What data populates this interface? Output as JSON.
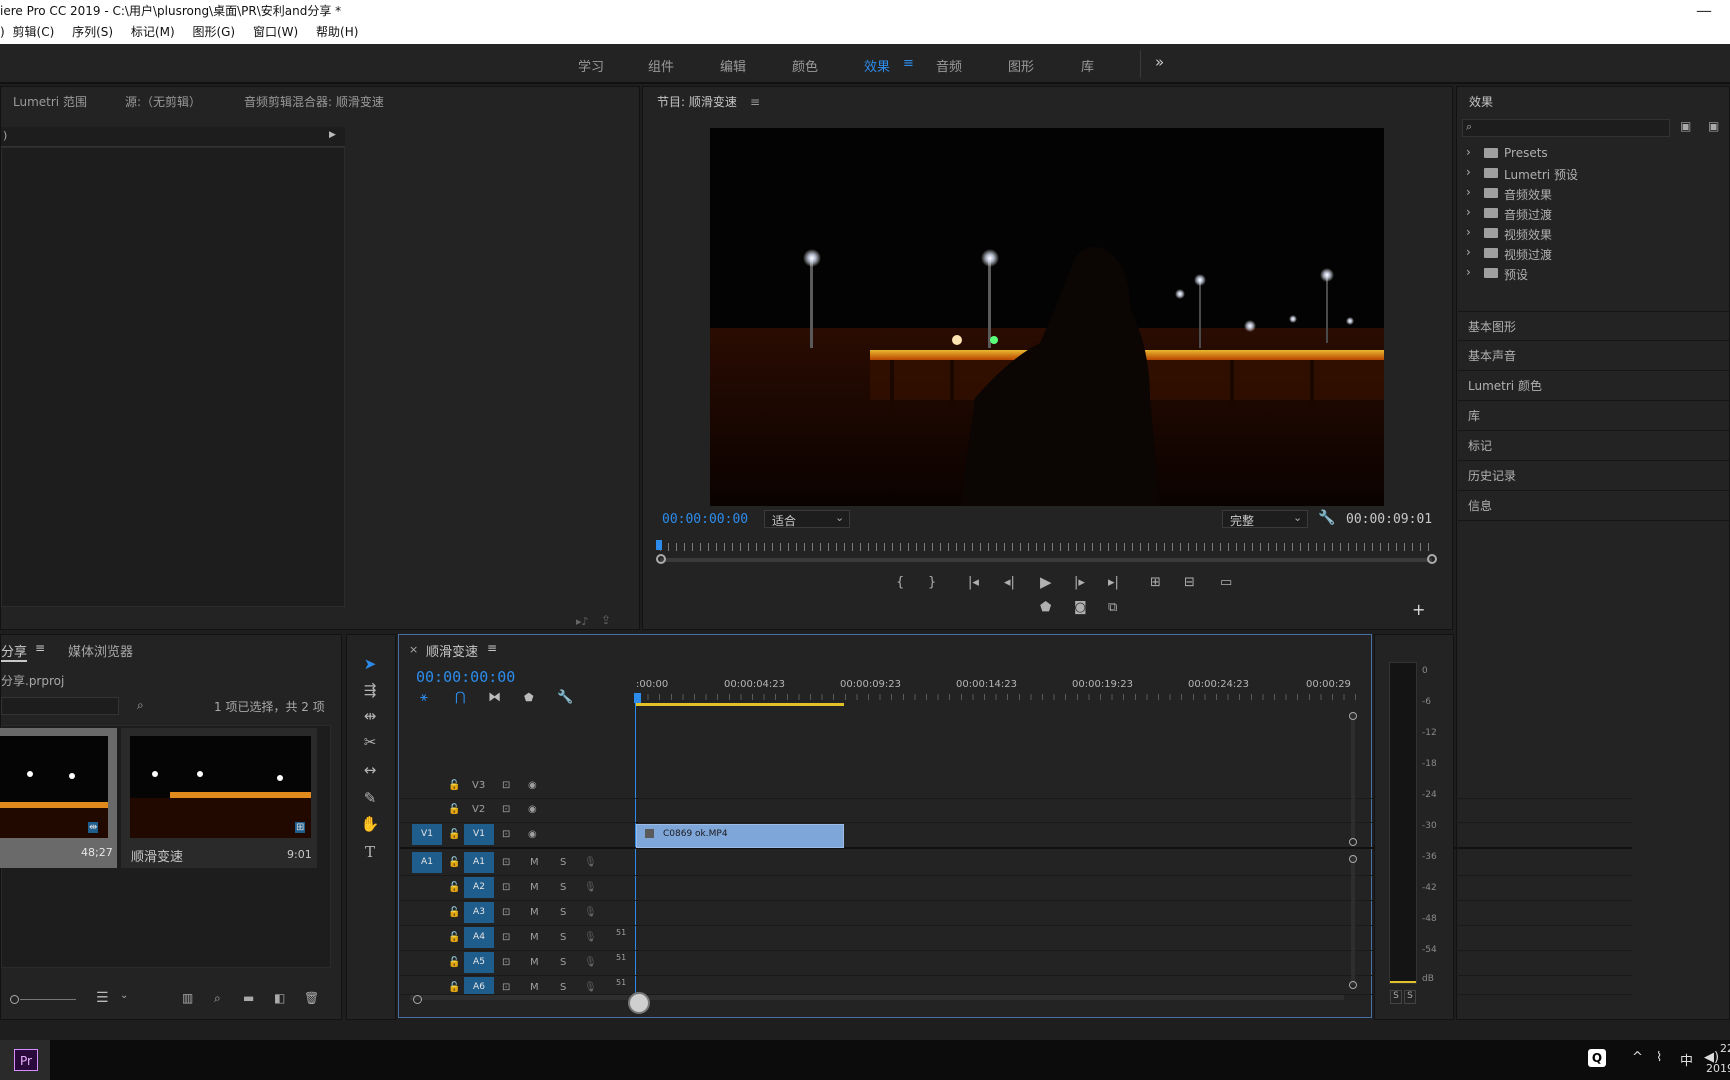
{
  "window": {
    "title": "iere Pro CC 2019 - C:\\用户\\plusrong\\桌面\\PR\\安利and分享 *",
    "close_icon": "close-icon"
  },
  "menu": [
    "剪辑(C)",
    "序列(S)",
    "标记(M)",
    "图形(G)",
    "窗口(W)",
    "帮助(H)"
  ],
  "menu_lead": ")",
  "workspaces": {
    "tabs": [
      "学习",
      "组件",
      "编辑",
      "颜色",
      "效果",
      "音频",
      "图形",
      "库"
    ],
    "active": "效果",
    "menu_glyph": "≡",
    "overflow": "»"
  },
  "source_panel": {
    "tabs": [
      "Lumetri 范围",
      "源:（无剪辑）",
      "音频剪辑混合器: 顺滑变速"
    ],
    "dropdown_lead": ")"
  },
  "program_monitor": {
    "title": "节目: 顺滑变速",
    "menu_glyph": "≡",
    "timecode_current": "00:00:00:00",
    "fit_value": "适合",
    "quality_value": "完整",
    "timecode_duration": "00:00:09:01",
    "transport_buttons": [
      "mark-in",
      "mark-out",
      "go-to-in",
      "step-back",
      "play",
      "step-forward",
      "go-to-out",
      "lift",
      "extract",
      "compare"
    ],
    "lower_buttons": [
      "add-marker",
      "export-frame",
      "multi-cam"
    ],
    "add_glyph": "+"
  },
  "project_panel": {
    "tabs": [
      "分享",
      "媒体浏览器"
    ],
    "active_tab": "分享",
    "file": "分享.prproj",
    "selection_info": "1 项已选择，共 2 项",
    "items": [
      {
        "name": "",
        "duration": "48;27",
        "selected": true
      },
      {
        "name": "顺滑变速",
        "duration": "9:01",
        "selected": false
      }
    ]
  },
  "timeline": {
    "title": "顺滑变速",
    "close_glyph": "×",
    "menu_glyph": "≡",
    "timecode": "00:00:00:00",
    "ruler_labels": [
      ":00:00",
      "00:00:04:23",
      "00:00:09:23",
      "00:00:14:23",
      "00:00:19:23",
      "00:00:24:23",
      "00:00:29"
    ],
    "video_tracks": [
      {
        "label": "V3",
        "source": ""
      },
      {
        "label": "V2",
        "source": ""
      },
      {
        "label": "V1",
        "source": "V1"
      }
    ],
    "audio_tracks": [
      {
        "label": "A1",
        "source": "A1",
        "level": ""
      },
      {
        "label": "A2",
        "source": "",
        "level": ""
      },
      {
        "label": "A3",
        "source": "",
        "level": ""
      },
      {
        "label": "A4",
        "source": "",
        "level": "51"
      },
      {
        "label": "A5",
        "source": "",
        "level": "51"
      },
      {
        "label": "A6",
        "source": "",
        "level": "51"
      }
    ],
    "mute_label": "M",
    "solo_label": "S",
    "clip": {
      "name": "C0869 ok.MP4",
      "fx_badge": "fx"
    }
  },
  "audio_meter": {
    "labels": [
      "0",
      "-6",
      "-12",
      "-18",
      "-24",
      "-30",
      "-36",
      "-42",
      "-48",
      "-54",
      "dB"
    ],
    "solo_buttons": [
      "S",
      "S"
    ]
  },
  "effects_panel": {
    "title": "效果",
    "search_placeholder": "",
    "folders": [
      "Presets",
      "Lumetri 预设",
      "音频效果",
      "音频过渡",
      "视频效果",
      "视频过渡",
      "预设"
    ],
    "side_panels": [
      "基本图形",
      "基本声音",
      "Lumetri 颜色",
      "库",
      "标记",
      "历史记录",
      "信息"
    ]
  },
  "taskbar": {
    "app_label": "Pr",
    "ime": "中",
    "clock_top": "22",
    "clock_bottom": "2019"
  },
  "colors": {
    "accent": "#2d8ceb",
    "track_blue": "#1f5d8c",
    "clip": "#7fa6d9",
    "panel_bg": "#232323"
  }
}
